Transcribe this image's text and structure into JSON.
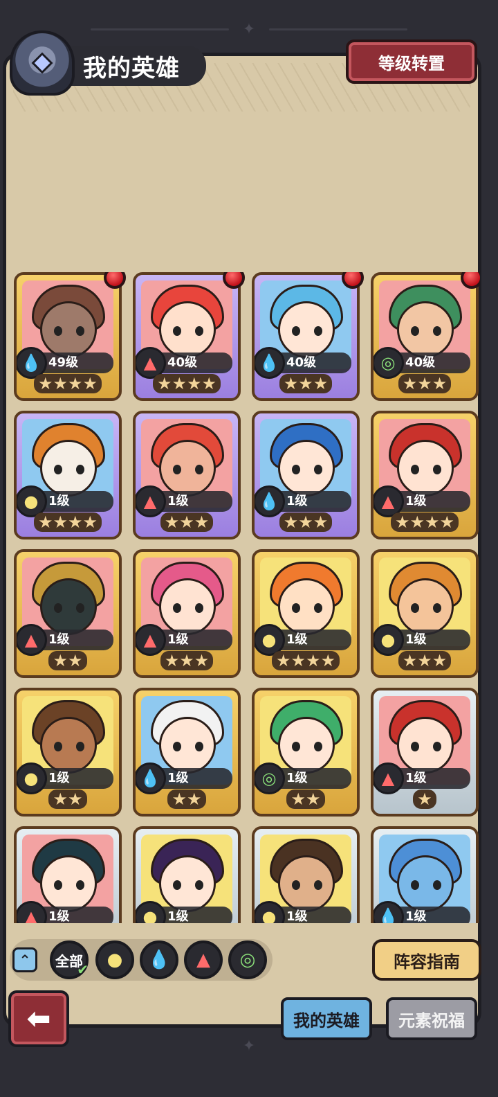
{
  "header": {
    "title": "我的英雄",
    "level_transfer_label": "等级转置"
  },
  "heroes": [
    {
      "level": "49级",
      "stars": 4,
      "element": "water",
      "frame": "gold",
      "bg": "pink",
      "hair": "#7a4a3a",
      "skin": "#9e7a6a",
      "new": true
    },
    {
      "level": "40级",
      "stars": 4,
      "element": "fire",
      "frame": "purple",
      "bg": "pink",
      "hair": "#e8453c",
      "skin": "#ffe0cc",
      "new": true
    },
    {
      "level": "40级",
      "stars": 3,
      "element": "water",
      "frame": "purple",
      "bg": "blue",
      "hair": "#5cb8e6",
      "skin": "#ffe6d6",
      "new": true
    },
    {
      "level": "40级",
      "stars": 3,
      "element": "wind",
      "frame": "gold",
      "bg": "pink",
      "hair": "#3e8f5e",
      "skin": "#f2c6a4",
      "new": true
    },
    {
      "level": "1级",
      "stars": 4,
      "element": "earth",
      "frame": "purple",
      "bg": "blue",
      "hair": "#e0822e",
      "skin": "#f6efe6",
      "new": false
    },
    {
      "level": "1级",
      "stars": 3,
      "element": "fire",
      "frame": "purple",
      "bg": "pink",
      "hair": "#e24a3a",
      "skin": "#f0b49a",
      "new": false
    },
    {
      "level": "1级",
      "stars": 3,
      "element": "water",
      "frame": "purple",
      "bg": "blue",
      "hair": "#2f6fc4",
      "skin": "#ffe6d6",
      "new": false
    },
    {
      "level": "1级",
      "stars": 4,
      "element": "fire",
      "frame": "gold",
      "bg": "pink",
      "hair": "#c9322c",
      "skin": "#ffe3d2",
      "new": false
    },
    {
      "level": "1级",
      "stars": 2,
      "element": "fire",
      "frame": "gold",
      "bg": "pink",
      "hair": "#c69a3a",
      "skin": "#2f3a3a",
      "new": false
    },
    {
      "level": "1级",
      "stars": 3,
      "element": "fire",
      "frame": "gold",
      "bg": "pink",
      "hair": "#e55a8a",
      "skin": "#ffe3d2",
      "new": false
    },
    {
      "level": "1级",
      "stars": 4,
      "element": "earth",
      "frame": "gold",
      "bg": "yellow",
      "hair": "#f07a2e",
      "skin": "#ffe0c4",
      "new": false
    },
    {
      "level": "1级",
      "stars": 3,
      "element": "earth",
      "frame": "gold",
      "bg": "yellow",
      "hair": "#e08a32",
      "skin": "#f4c49a",
      "new": false
    },
    {
      "level": "1级",
      "stars": 2,
      "element": "earth",
      "frame": "gold",
      "bg": "yellow",
      "hair": "#6b4226",
      "skin": "#b87a52",
      "new": false
    },
    {
      "level": "1级",
      "stars": 2,
      "element": "water",
      "frame": "gold",
      "bg": "blue",
      "hair": "#f2f2f2",
      "skin": "#ffe6d6",
      "new": false
    },
    {
      "level": "1级",
      "stars": 2,
      "element": "wind",
      "frame": "gold",
      "bg": "yellow",
      "hair": "#3fae6a",
      "skin": "#ffe6d6",
      "new": false
    },
    {
      "level": "1级",
      "stars": 1,
      "element": "fire",
      "frame": "silver",
      "bg": "pink",
      "hair": "#c9322c",
      "skin": "#ffe3d2",
      "new": false
    },
    {
      "level": "1级",
      "stars": 0,
      "element": "fire",
      "frame": "silver",
      "bg": "pink",
      "hair": "#1f3a44",
      "skin": "#ffe6d6",
      "new": false
    },
    {
      "level": "1级",
      "stars": 0,
      "element": "earth",
      "frame": "silver",
      "bg": "yellow",
      "hair": "#3a2456",
      "skin": "#ffe6d6",
      "new": false
    },
    {
      "level": "1级",
      "stars": 0,
      "element": "earth",
      "frame": "silver",
      "bg": "yellow",
      "hair": "#4a3222",
      "skin": "#e0b08a",
      "new": false
    },
    {
      "level": "1级",
      "stars": 0,
      "element": "water",
      "frame": "silver",
      "bg": "blue",
      "hair": "#4d8fd6",
      "skin": "#7ab8e8",
      "new": false
    }
  ],
  "filters": {
    "all_label": "全部",
    "elements": [
      "earth",
      "water",
      "fire",
      "wind"
    ]
  },
  "guide_label": "阵容指南",
  "tabs": {
    "my_heroes": "我的英雄",
    "element_blessing": "元素祝福"
  },
  "icons": {
    "water": "water-drop-icon",
    "fire": "flame-icon",
    "earth": "earth-swirl-icon",
    "wind": "wind-swirl-icon"
  }
}
